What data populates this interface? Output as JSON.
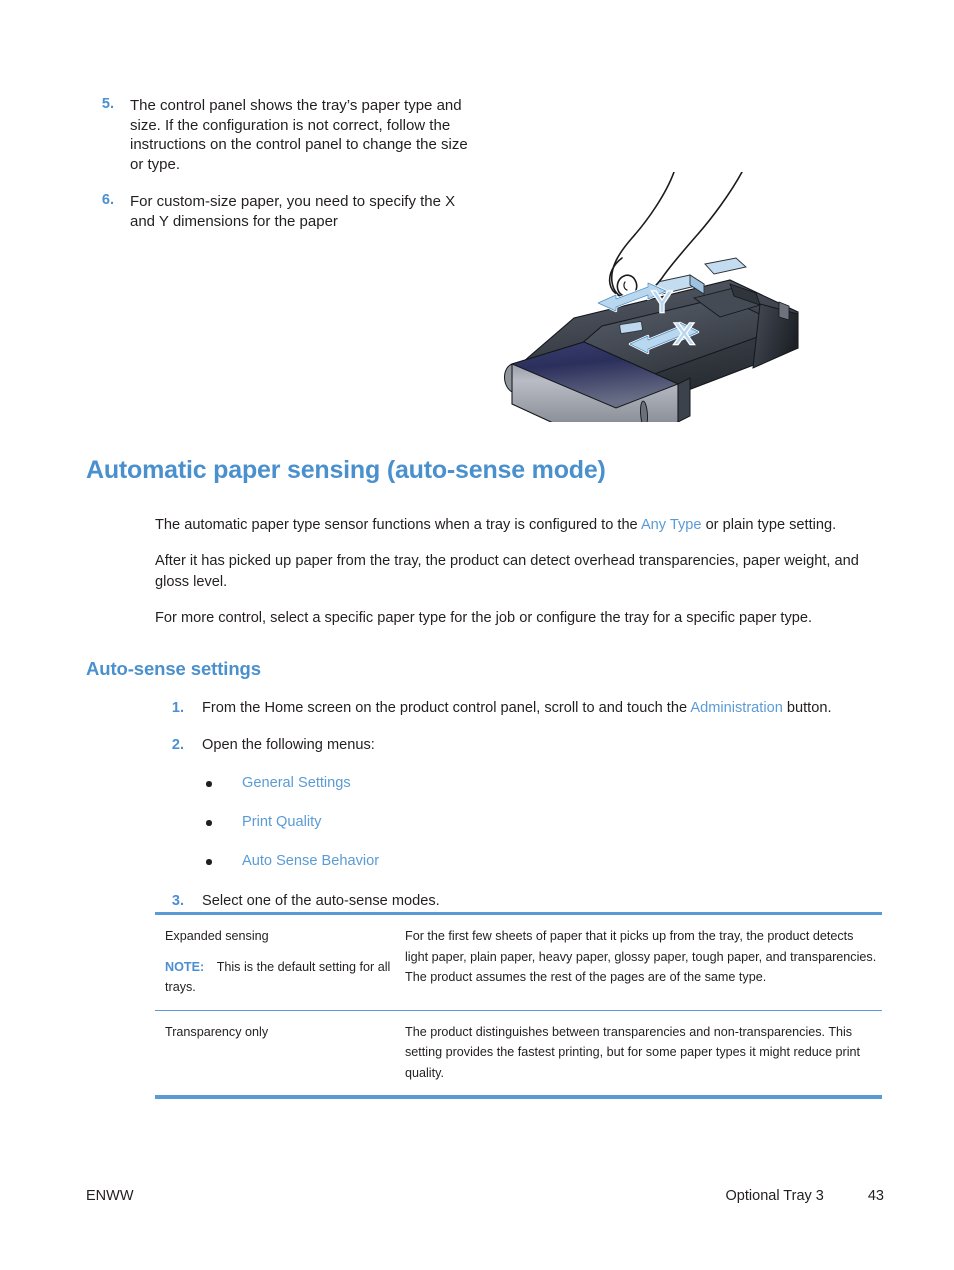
{
  "document": {
    "steps_top": [
      {
        "number": "5.",
        "text": "The control panel shows the tray’s paper type and size. If the configuration is not correct, follow the instructions on the control panel to change the size or type."
      },
      {
        "number": "6.",
        "text": "For custom-size paper, you need to specify the X and Y dimensions for the paper"
      }
    ],
    "illustration": {
      "name": "printer-paper-tray-xy-adjustment",
      "label_y": "Y",
      "label_x": "X",
      "accent_color": "#b9d7ee",
      "outline_color": "#1b1b1b"
    },
    "heading1": "Automatic paper sensing (auto-sense mode)",
    "paragraphs": {
      "p1_a": "The automatic paper type sensor functions when a tray is configured to the ",
      "p1_link": "Any Type",
      "p1_b": " or plain type setting.",
      "p2": "After it has picked up paper from the tray, the product can detect overhead transparencies, paper weight, and gloss level.",
      "p3": "For more control, select a specific paper type for the job or configure the tray for a specific paper type."
    },
    "heading2": "Auto-sense settings",
    "steps": [
      {
        "number": "1.",
        "text_a": "From the Home screen on the product control panel, scroll to and touch the ",
        "link": "Administration",
        "text_b": " button."
      },
      {
        "number": "2.",
        "text_a": "Open the following menus:",
        "link": "",
        "text_b": "",
        "bullets": [
          "General Settings",
          "Print Quality",
          "Auto Sense Behavior"
        ]
      },
      {
        "number": "3.",
        "text_a": "Select one of the auto-sense modes.",
        "link": "",
        "text_b": ""
      }
    ],
    "table": {
      "rows": [
        {
          "mode": "Expanded sensing",
          "note_label": "NOTE:",
          "note_text": "This is the default setting for all trays.",
          "description": "For the first few sheets of paper that it picks up from the tray, the product detects light paper, plain paper, heavy paper, glossy paper, tough paper, and transparencies. The product assumes the rest of the pages are of the same type."
        },
        {
          "mode": "Transparency only",
          "note_label": "",
          "note_text": "",
          "description": "The product distinguishes between transparencies and non-transparencies. This setting provides the fastest printing, but for some paper types it might reduce print quality."
        }
      ]
    },
    "footer": {
      "left": "ENWW",
      "chapter": "Optional Tray 3",
      "page_number": "43"
    },
    "colors": {
      "heading_blue": "#4a90cd",
      "link_blue": "#5b9bd5",
      "rule_blue": "#5b9bd5",
      "text_black": "#231f20"
    }
  }
}
